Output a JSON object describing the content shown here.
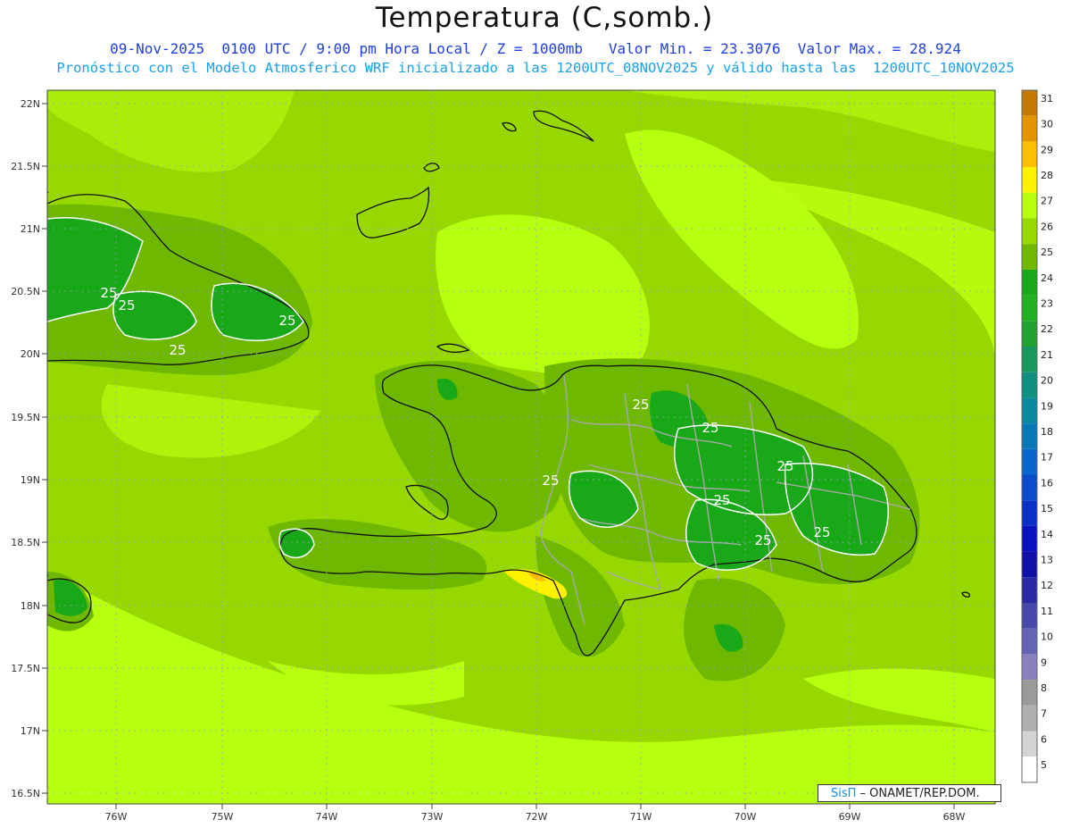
{
  "header": {
    "title": "Temperatura (C,somb.)",
    "line1": "09-Nov-2025  0100 UTC / 9:00 pm Hora Local / Z = 1000mb   Valor Min. = 23.3076  Valor Max. = 28.924",
    "line2": "Pronóstico con el Modelo Atmosferico WRF inicializado a las 1200UTC_08NOV2025 y válido hasta las  1200UTC_10NOV2025"
  },
  "axes": {
    "lat_labels": [
      "22N",
      "21.5N",
      "21N",
      "20.5N",
      "20N",
      "19.5N",
      "19N",
      "18.5N",
      "18N",
      "17.5N",
      "17N",
      "16.5N"
    ],
    "lon_labels": [
      "76W",
      "75W",
      "74W",
      "73W",
      "72W",
      "71W",
      "70W",
      "69W",
      "68W"
    ]
  },
  "contour_labels": [
    "25",
    "25",
    "25",
    "25",
    "25",
    "25",
    "25",
    "25",
    "25",
    "25",
    "25"
  ],
  "legend": {
    "values": [
      "31",
      "30",
      "29",
      "28",
      "27",
      "26",
      "25",
      "24",
      "23",
      "22",
      "21",
      "20",
      "19",
      "18",
      "17",
      "16",
      "15",
      "14",
      "13",
      "12",
      "11",
      "10",
      "9",
      "8",
      "7",
      "6",
      "5"
    ],
    "colors": [
      "#c47a00",
      "#e49400",
      "#ffbe00",
      "#fff200",
      "#b9ff10",
      "#96d800",
      "#6eb800",
      "#18a818",
      "#20b020",
      "#22a030",
      "#18985c",
      "#109080",
      "#0a8aa0",
      "#0878b8",
      "#0866cc",
      "#0a4ccc",
      "#0a30c8",
      "#0a12c0",
      "#1010a8",
      "#2a2aa6",
      "#4848aa",
      "#6464b4",
      "#8a80bc",
      "#9a9a9a",
      "#b0b0b0",
      "#d4d4d4",
      "#ffffff"
    ]
  },
  "credit": {
    "brand": "SisΠ",
    "text": " – ONAMET/REP.DOM."
  }
}
